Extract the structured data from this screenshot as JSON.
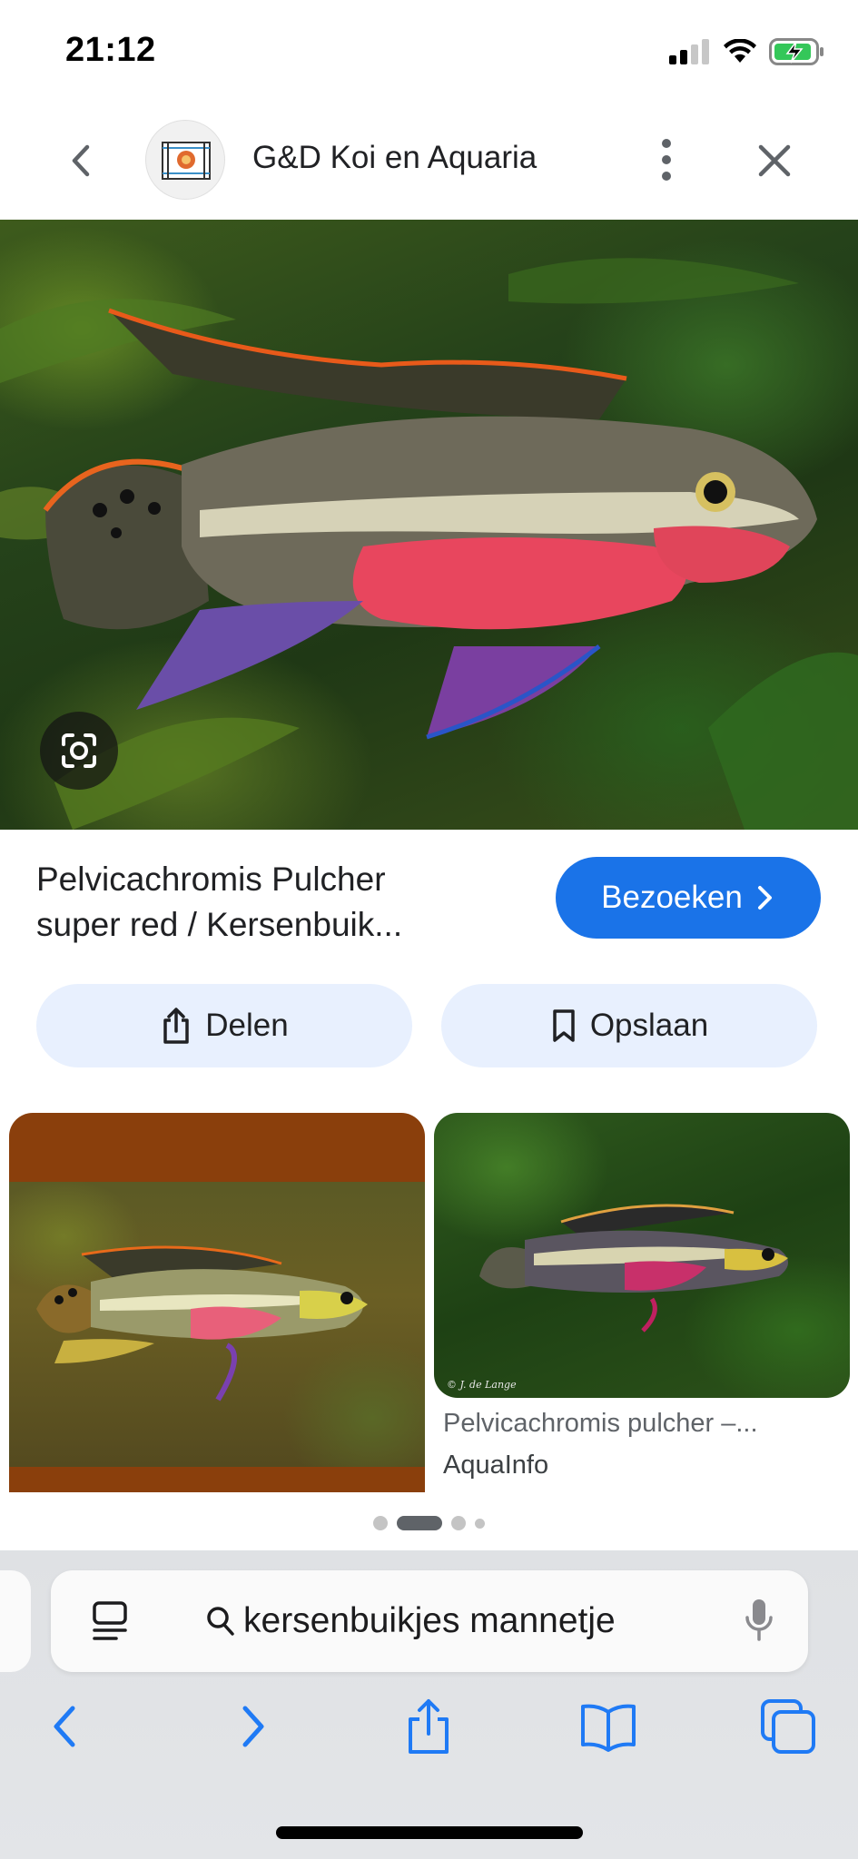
{
  "status_bar": {
    "time": "21:12"
  },
  "header": {
    "site_name": "G&D Koi en Aquaria"
  },
  "result": {
    "title_line1": "Pelvicachromis Pulcher",
    "title_line2": "super red / Kersenbuik...",
    "visit_label": "Bezoeken",
    "share_label": "Delen",
    "save_label": "Opslaan"
  },
  "related": [
    {
      "title": "",
      "source": ""
    },
    {
      "title": "Pelvicachromis pulcher –...",
      "source": "AquaInfo",
      "credit": "© J. de Lange"
    }
  ],
  "pager": {
    "count": 4,
    "active_index": 1
  },
  "address_bar": {
    "query": "kersenbuikjes mannetje"
  },
  "colors": {
    "accent": "#1a73e8",
    "pill_bg": "#e8f0fe",
    "safari_blue": "#1f7af5"
  },
  "icons": [
    "back-chevron-icon",
    "kebab-icon",
    "close-icon",
    "lens-icon",
    "share-icon",
    "bookmark-icon",
    "reader-icon",
    "search-icon",
    "mic-icon",
    "safari-back-icon",
    "safari-forward-icon",
    "safari-share-icon",
    "bookmarks-icon",
    "tabs-icon"
  ]
}
